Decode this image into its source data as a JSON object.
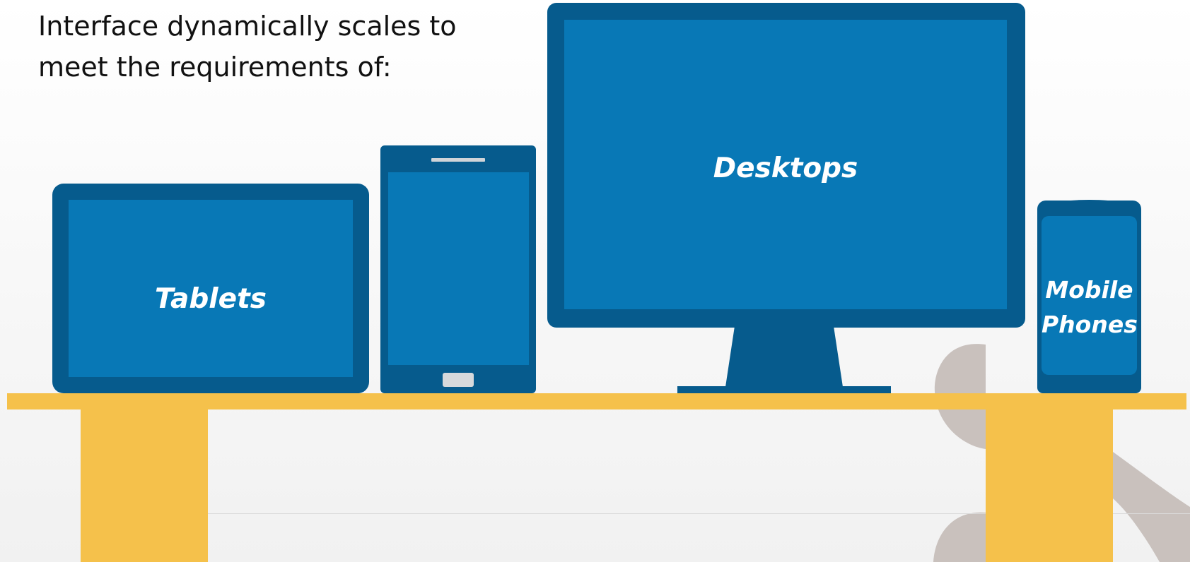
{
  "headline": {
    "line1": "Interface dynamically scales to",
    "line2": "meet the requirements of:"
  },
  "devices": {
    "tablet": {
      "label": "Tablets"
    },
    "desktop": {
      "label": "Desktops"
    },
    "mobile": {
      "line1": "Mobile",
      "line2": "Phones"
    }
  },
  "colors": {
    "device_frame": "#065b8d",
    "device_screen": "#0878b6",
    "table": "#f5c14b",
    "decoration": "#c9c1bd",
    "text": "#111111",
    "label_text": "#ffffff"
  },
  "icons": [
    "speaker-slot-icon",
    "home-button-icon"
  ]
}
